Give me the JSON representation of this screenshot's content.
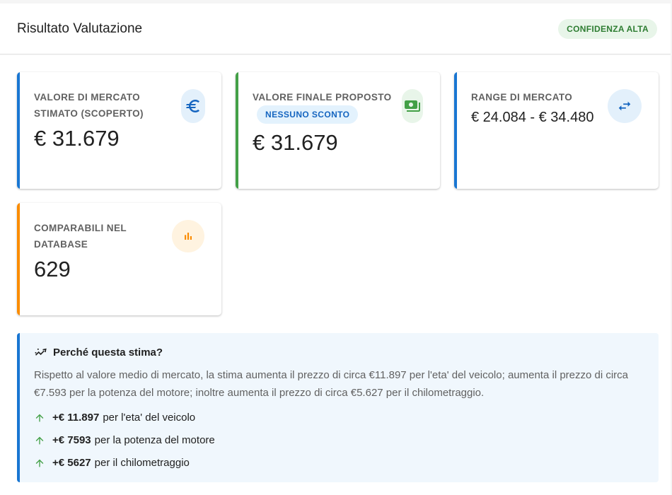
{
  "header": {
    "title": "Risultato Valutazione",
    "confidence": "CONFIDENZA ALTA"
  },
  "cards": {
    "market_value": {
      "label_line1": "VALORE DI MERCATO",
      "label_line2": "STIMATO (SCOPERTO)",
      "value": "€ 31.679",
      "icon": "euro-icon",
      "accent": "#1976d2"
    },
    "final_value": {
      "label": "VALORE FINALE PROPOSTO",
      "chip": "NESSUNO SCONTO",
      "value": "€ 31.679",
      "icon": "money-icon",
      "accent": "#43a047"
    },
    "market_range": {
      "label": "RANGE DI MERCATO",
      "value": "€ 24.084 - € 34.480",
      "icon": "swap-icon",
      "accent": "#1976d2"
    },
    "comparables": {
      "label_line1": "COMPARABILI NEL",
      "label_line2": "DATABASE",
      "value": "629",
      "icon": "bar-chart-icon",
      "accent": "#fb8c00"
    }
  },
  "explanation": {
    "title": "Perché questa stima?",
    "text": "Rispetto al valore medio di mercato, la stima aumenta il prezzo di circa €11.897 per l'eta' del veicolo; aumenta il prezzo di circa €7.593 per la potenza del motore; inoltre aumenta il prezzo di circa €5.627 per il chilometraggio.",
    "factors": [
      {
        "amount": "+€ 11.897",
        "desc": "per l'eta' del veicolo"
      },
      {
        "amount": "+€ 7593",
        "desc": "per la potenza del motore"
      },
      {
        "amount": "+€ 5627",
        "desc": "per il chilometraggio"
      }
    ]
  }
}
